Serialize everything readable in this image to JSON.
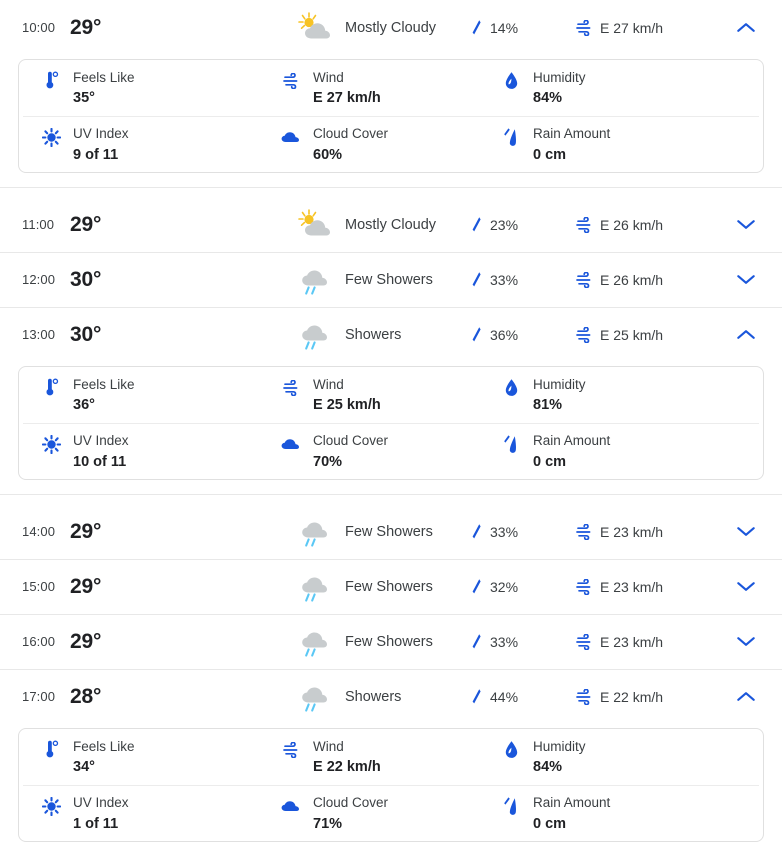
{
  "theme": {
    "accent_blue": "#1a56db",
    "rain_blue": "#5bc8f5",
    "cloud_gray": "#c8ccce",
    "sun_yellow": "#f7c325",
    "text_primary": "#202124",
    "text_secondary": "#3c4043",
    "divider": "#e8e8e8"
  },
  "detail_labels": {
    "feels_like": "Feels Like",
    "wind": "Wind",
    "humidity": "Humidity",
    "uv_index": "UV Index",
    "cloud_cover": "Cloud Cover",
    "rain_amount": "Rain Amount"
  },
  "icons": {
    "mostly_cloudy": "sun-behind-cloud-icon",
    "showers": "rain-cloud-icon",
    "precip": "raindrop-icon",
    "wind": "wind-lines-icon",
    "chevron_up": "chevron-up-icon",
    "chevron_down": "chevron-down-icon",
    "feels_like": "thermometer-icon",
    "humidity": "water-drop-icon",
    "uv_index": "sun-burst-icon",
    "cloud_cover": "cloud-icon",
    "rain_amount": "rain-streaks-icon"
  },
  "hours": [
    {
      "time": "10:00",
      "temp": "29°",
      "condition": "Mostly Cloudy",
      "condition_icon": "mostly_cloudy",
      "precip": "14%",
      "wind": "E 27 km/h",
      "expanded": true,
      "toggle_icon": "chevron_up",
      "details": {
        "feels_like": "35°",
        "wind": "E 27 km/h",
        "humidity": "84%",
        "uv_index": "9 of 11",
        "cloud_cover": "60%",
        "rain_amount": "0 cm"
      }
    },
    {
      "time": "11:00",
      "temp": "29°",
      "condition": "Mostly Cloudy",
      "condition_icon": "mostly_cloudy",
      "precip": "23%",
      "wind": "E 26 km/h",
      "expanded": false,
      "toggle_icon": "chevron_down",
      "details": null
    },
    {
      "time": "12:00",
      "temp": "30°",
      "condition": "Few Showers",
      "condition_icon": "showers",
      "precip": "33%",
      "wind": "E 26 km/h",
      "expanded": false,
      "toggle_icon": "chevron_down",
      "details": null
    },
    {
      "time": "13:00",
      "temp": "30°",
      "condition": "Showers",
      "condition_icon": "showers",
      "precip": "36%",
      "wind": "E 25 km/h",
      "expanded": true,
      "toggle_icon": "chevron_up",
      "details": {
        "feels_like": "36°",
        "wind": "E 25 km/h",
        "humidity": "81%",
        "uv_index": "10 of 11",
        "cloud_cover": "70%",
        "rain_amount": "0 cm"
      }
    },
    {
      "time": "14:00",
      "temp": "29°",
      "condition": "Few Showers",
      "condition_icon": "showers",
      "precip": "33%",
      "wind": "E 23 km/h",
      "expanded": false,
      "toggle_icon": "chevron_down",
      "details": null
    },
    {
      "time": "15:00",
      "temp": "29°",
      "condition": "Few Showers",
      "condition_icon": "showers",
      "precip": "32%",
      "wind": "E 23 km/h",
      "expanded": false,
      "toggle_icon": "chevron_down",
      "details": null
    },
    {
      "time": "16:00",
      "temp": "29°",
      "condition": "Few Showers",
      "condition_icon": "showers",
      "precip": "33%",
      "wind": "E 23 km/h",
      "expanded": false,
      "toggle_icon": "chevron_down",
      "details": null
    },
    {
      "time": "17:00",
      "temp": "28°",
      "condition": "Showers",
      "condition_icon": "showers",
      "precip": "44%",
      "wind": "E 22 km/h",
      "expanded": true,
      "toggle_icon": "chevron_up",
      "details": {
        "feels_like": "34°",
        "wind": "E 22 km/h",
        "humidity": "84%",
        "uv_index": "1 of 11",
        "cloud_cover": "71%",
        "rain_amount": "0 cm"
      }
    }
  ]
}
